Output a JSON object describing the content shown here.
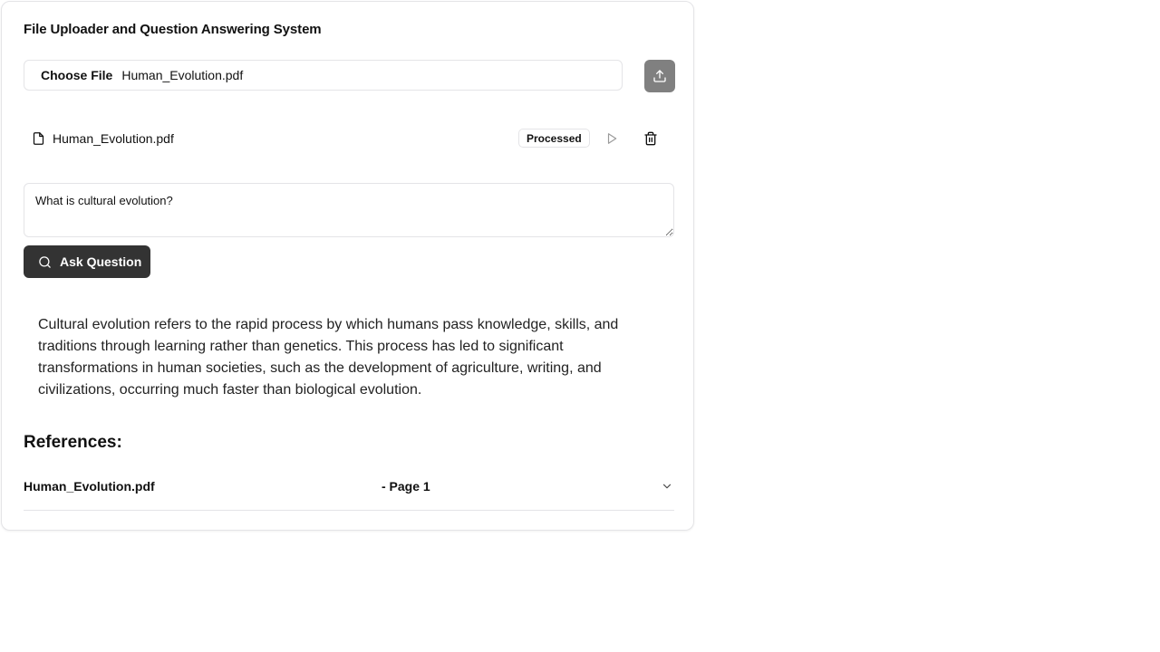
{
  "app": {
    "title": "File Uploader and Question Answering System"
  },
  "uploader": {
    "choose_label": "Choose File",
    "selected_file": "Human_Evolution.pdf",
    "upload_icon": "upload-icon"
  },
  "files": [
    {
      "name": "Human_Evolution.pdf",
      "status": "Processed",
      "icons": [
        "file-icon",
        "play-icon",
        "trash-icon"
      ]
    }
  ],
  "question": {
    "value": "What is cultural evolution?",
    "ask_label": "Ask Question"
  },
  "answer": {
    "text": "Cultural evolution refers to the rapid process by which humans pass knowledge, skills, and traditions through learning rather than genetics. This process has led to significant transformations in human societies, such as the development of agriculture, writing, and civilizations, occurring much faster than biological evolution."
  },
  "references": {
    "title": "References:",
    "items": [
      {
        "file": "Human_Evolution.pdf",
        "page": "- Page 1"
      }
    ]
  },
  "colors": {
    "upload_button": "#808080",
    "ask_button": "#333333",
    "border": "#e4e4e7"
  }
}
